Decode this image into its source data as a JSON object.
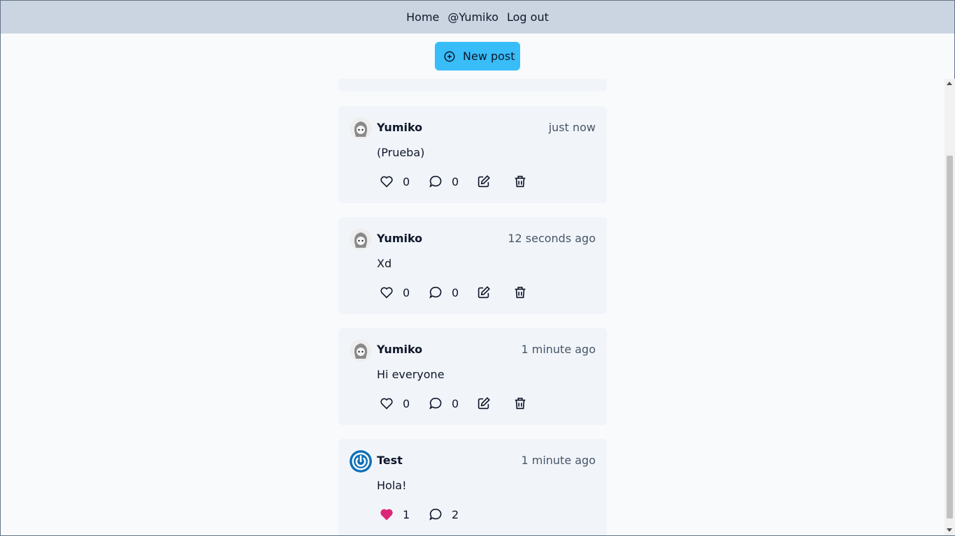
{
  "nav": {
    "home": "Home",
    "user": "@Yumiko",
    "logout": "Log out"
  },
  "new_post": {
    "label": "New post"
  },
  "posts": [
    {
      "author": "Yumiko",
      "time": "just now",
      "text": "(Prueba)",
      "likes": "0",
      "comments": "0",
      "liked": false,
      "owner": true
    },
    {
      "author": "Yumiko",
      "time": "12 seconds ago",
      "text": "Xd",
      "likes": "0",
      "comments": "0",
      "liked": false,
      "owner": true
    },
    {
      "author": "Yumiko",
      "time": "1 minute ago",
      "text": "Hi everyone",
      "likes": "0",
      "comments": "0",
      "liked": false,
      "owner": true
    },
    {
      "author": "Test",
      "time": "1 minute ago",
      "text": "Hola!",
      "likes": "1",
      "comments": "2",
      "liked": true,
      "owner": false
    }
  ],
  "colors": {
    "topbar": "#cbd5e1",
    "accent": "#38bdf8",
    "card": "#f1f5f9",
    "liked": "#db2777",
    "test_avatar": "#0e6fb8"
  }
}
